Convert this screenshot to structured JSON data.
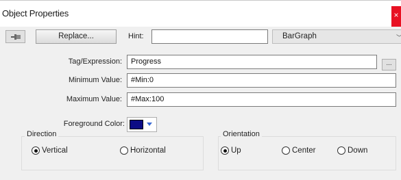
{
  "window": {
    "title": "Object Properties",
    "close_glyph": "×"
  },
  "toolbar": {
    "pin_icon": "pin-icon",
    "replace_label": "Replace...",
    "hint_label": "Hint:",
    "hint_value": "",
    "object_type": "BarGraph",
    "object_type_arrow": "﹀"
  },
  "fields": {
    "tag_label": "Tag/Expression:",
    "tag_value": "Progress",
    "ellipsis_label": "...",
    "min_label": "Minimum Value:",
    "min_value": "#Min:0",
    "max_label": "Maximum Value:",
    "max_value": "#Max:100",
    "fg_label": "Foreground Color:",
    "fg_color": "#0c0c85"
  },
  "direction": {
    "legend": "Direction",
    "options": [
      {
        "label": "Vertical",
        "checked": true
      },
      {
        "label": "Horizontal",
        "checked": false
      }
    ]
  },
  "orientation": {
    "legend": "Orientation",
    "options": [
      {
        "label": "Up",
        "checked": true
      },
      {
        "label": "Center",
        "checked": false
      },
      {
        "label": "Down",
        "checked": false
      }
    ]
  }
}
